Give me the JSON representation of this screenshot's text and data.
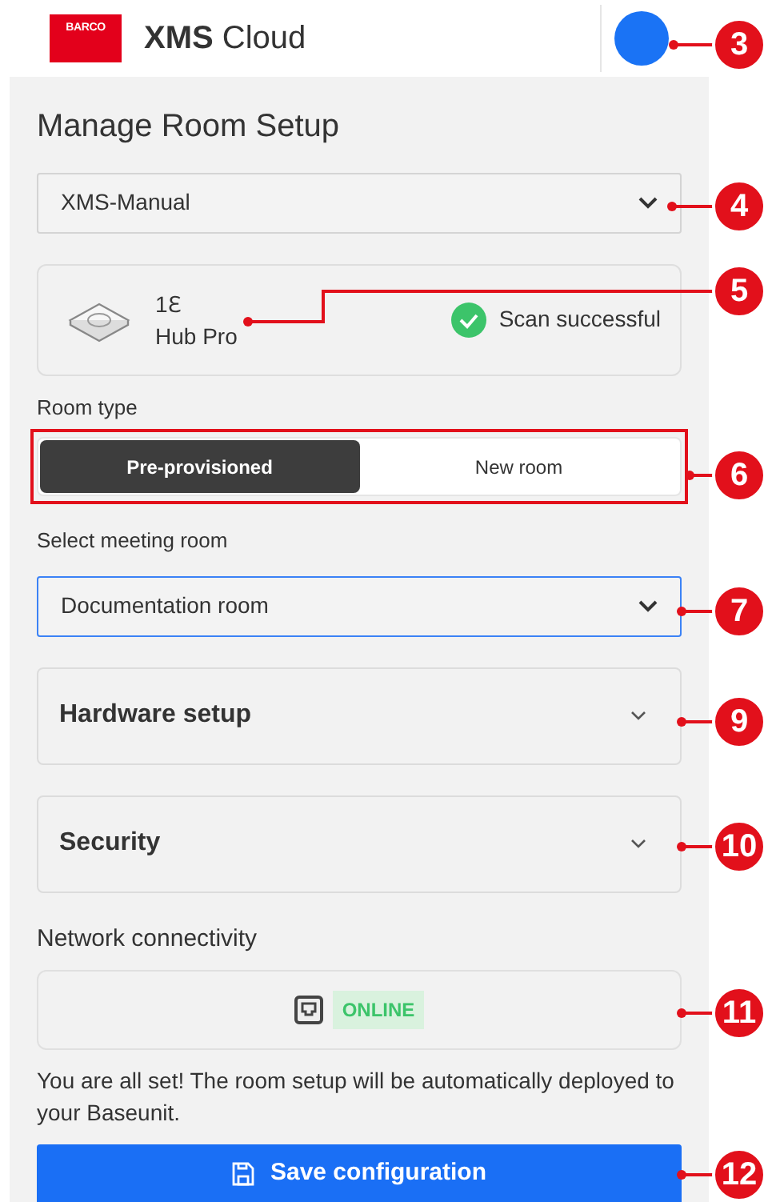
{
  "header": {
    "logo": "BARCO",
    "app_title_bold": "XMS",
    "app_title_rest": "Cloud"
  },
  "title": "Manage Room Setup",
  "site_select": {
    "value": "XMS-Manual"
  },
  "device": {
    "name": "1ℇ",
    "model": "Hub Pro",
    "scan_status": "Scan successful"
  },
  "room_type": {
    "label": "Room type",
    "options": [
      {
        "label": "Pre-provisioned",
        "selected": true
      },
      {
        "label": "New room",
        "selected": false
      }
    ]
  },
  "meeting_room": {
    "label": "Select meeting room",
    "value": "Documentation room",
    "focused": true
  },
  "sections": [
    {
      "title": "Hardware setup",
      "expanded": false
    },
    {
      "title": "Security",
      "expanded": false
    }
  ],
  "network": {
    "label": "Network connectivity",
    "status": "ONLINE"
  },
  "message": "You are all set! The room setup will be automatically deployed to your Baseunit.",
  "save_button": "Save configuration",
  "callouts": [
    {
      "number": "3"
    },
    {
      "number": "4"
    },
    {
      "number": "5"
    },
    {
      "number": "6"
    },
    {
      "number": "7"
    },
    {
      "number": "9"
    },
    {
      "number": "10"
    },
    {
      "number": "11"
    },
    {
      "number": "12"
    }
  ]
}
